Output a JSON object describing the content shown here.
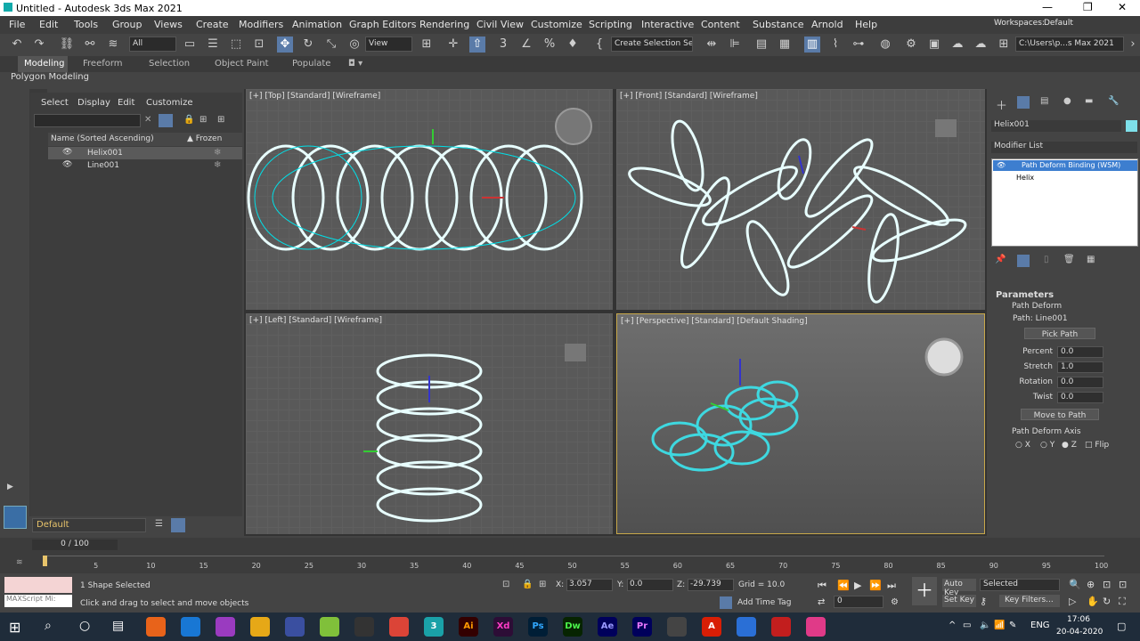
{
  "window": {
    "title": "Untitled - Autodesk 3ds Max 2021"
  },
  "menu": [
    "File",
    "Edit",
    "Tools",
    "Group",
    "Views",
    "Create",
    "Modifiers",
    "Animation",
    "Graph Editors",
    "Rendering",
    "Civil View",
    "Customize",
    "Scripting",
    "Interactive",
    "Content",
    "Substance",
    "Arnold",
    "Help"
  ],
  "workspace": {
    "label": "Workspaces:",
    "value": "Default"
  },
  "toolbar": {
    "filter": "All",
    "view": "View",
    "selection_set": "Create Selection Se",
    "path": "C:\\Users\\p...s Max 2021"
  },
  "ribbon": {
    "tabs": [
      "Modeling",
      "Freeform",
      "Selection",
      "Object Paint",
      "Populate"
    ],
    "sub": "Polygon Modeling"
  },
  "scene": {
    "menu": [
      "Select",
      "Display",
      "Edit",
      "Customize"
    ],
    "col_name": "Name (Sorted Ascending)",
    "col_frozen": "▲ Frozen",
    "items": [
      "Helix001",
      "Line001"
    ]
  },
  "viewports": {
    "top": "[+] [Top] [Standard] [Wireframe]",
    "front": "[+] [Front] [Standard] [Wireframe]",
    "left": "[+] [Left] [Standard] [Wireframe]",
    "persp": "[+] [Perspective] [Standard] [Default Shading]"
  },
  "cmd": {
    "object": "Helix001",
    "modlist": "Modifier List",
    "stack": [
      "Path Deform Binding (WSM)",
      "Helix"
    ],
    "params_title": "Parameters",
    "group": "Path Deform",
    "path_label": "Path: Line001",
    "pick": "Pick Path",
    "fields": [
      {
        "label": "Percent",
        "value": "0.0"
      },
      {
        "label": "Stretch",
        "value": "1.0"
      },
      {
        "label": "Rotation",
        "value": "0.0"
      },
      {
        "label": "Twist",
        "value": "0.0"
      }
    ],
    "move": "Move to Path",
    "axis_group": "Path Deform Axis",
    "axes": [
      "X",
      "Y",
      "Z",
      "Flip"
    ]
  },
  "layer": "Default",
  "time": {
    "counter": "0 / 100",
    "ticks": [
      "5",
      "10",
      "15",
      "20",
      "25",
      "30",
      "35",
      "40",
      "45",
      "50",
      "55",
      "60",
      "65",
      "70",
      "75",
      "80",
      "85",
      "90",
      "95",
      "100"
    ]
  },
  "status": {
    "script": "MAXScript Mi:",
    "selected": "1 Shape Selected",
    "prompt": "Click and drag to select and move objects",
    "x": "3.057",
    "y": "0.0",
    "z": "-29.739",
    "grid": "Grid = 10.0",
    "addkey": "Add Time Tag",
    "autokey": "Auto Key",
    "setkey": "Set Key",
    "sel": "Selected",
    "keyfilters": "Key Filters...",
    "frame": "0"
  },
  "taskbar": {
    "lang": "ENG",
    "time": "17:06",
    "date": "20-04-2020"
  }
}
